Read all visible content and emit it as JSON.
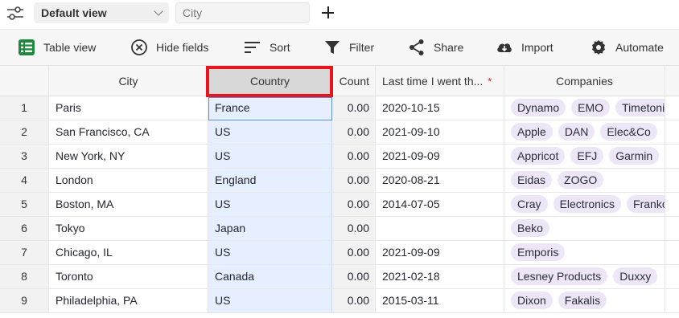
{
  "topbar": {
    "view_select": "Default view",
    "search_value": "City"
  },
  "toolbar": {
    "items": [
      {
        "label": "Table view",
        "icon": "table-icon"
      },
      {
        "label": "Hide fields",
        "icon": "hide-icon"
      },
      {
        "label": "Sort",
        "icon": "sort-icon"
      },
      {
        "label": "Filter",
        "icon": "filter-icon"
      },
      {
        "label": "Share",
        "icon": "share-icon"
      },
      {
        "label": "Import",
        "icon": "cloud-icon"
      },
      {
        "label": "Automate",
        "icon": "gear-icon"
      }
    ]
  },
  "columns": [
    "City",
    "Country",
    "Count",
    "Last time I went th...",
    "Companies"
  ],
  "required_mark": "*",
  "rows": [
    {
      "n": "1",
      "city": "Paris",
      "country": "France",
      "count": "0.00",
      "date": "2020-10-15",
      "companies": [
        "Dynamo",
        "EMO",
        "Timetoni"
      ]
    },
    {
      "n": "2",
      "city": "San Francisco, CA",
      "country": "US",
      "count": "0.00",
      "date": "2021-09-10",
      "companies": [
        "Apple",
        "DAN",
        "Elec&Co"
      ]
    },
    {
      "n": "3",
      "city": "New York, NY",
      "country": "US",
      "count": "0.00",
      "date": "2021-09-09",
      "companies": [
        "Appricot",
        "EFJ",
        "Garmin"
      ]
    },
    {
      "n": "4",
      "city": "London",
      "country": "England",
      "count": "0.00",
      "date": "2020-08-21",
      "companies": [
        "Eidas",
        "ZOGO"
      ]
    },
    {
      "n": "5",
      "city": "Boston, MA",
      "country": "US",
      "count": "0.00",
      "date": "2014-07-05",
      "companies": [
        "Cray",
        "Electronics",
        "Franko"
      ]
    },
    {
      "n": "6",
      "city": "Tokyo",
      "country": "Japan",
      "count": "0.00",
      "date": "",
      "companies": [
        "Beko"
      ]
    },
    {
      "n": "7",
      "city": "Chicago, IL",
      "country": "US",
      "count": "0.00",
      "date": "2021-09-09",
      "companies": [
        "Emporis"
      ]
    },
    {
      "n": "8",
      "city": "Toronto",
      "country": "Canada",
      "count": "0.00",
      "date": "2021-02-18",
      "companies": [
        "Lesney Products",
        "Duxxy"
      ]
    },
    {
      "n": "9",
      "city": "Philadelphia, PA",
      "country": "US",
      "count": "0.00",
      "date": "2015-03-11",
      "companies": [
        "Dixon",
        "Fakalis"
      ]
    }
  ],
  "colors": {
    "highlight": "#e8141e",
    "selected_column": "#e5efff",
    "chip": "#ece6f7",
    "table_icon": "#1e8a3c"
  }
}
